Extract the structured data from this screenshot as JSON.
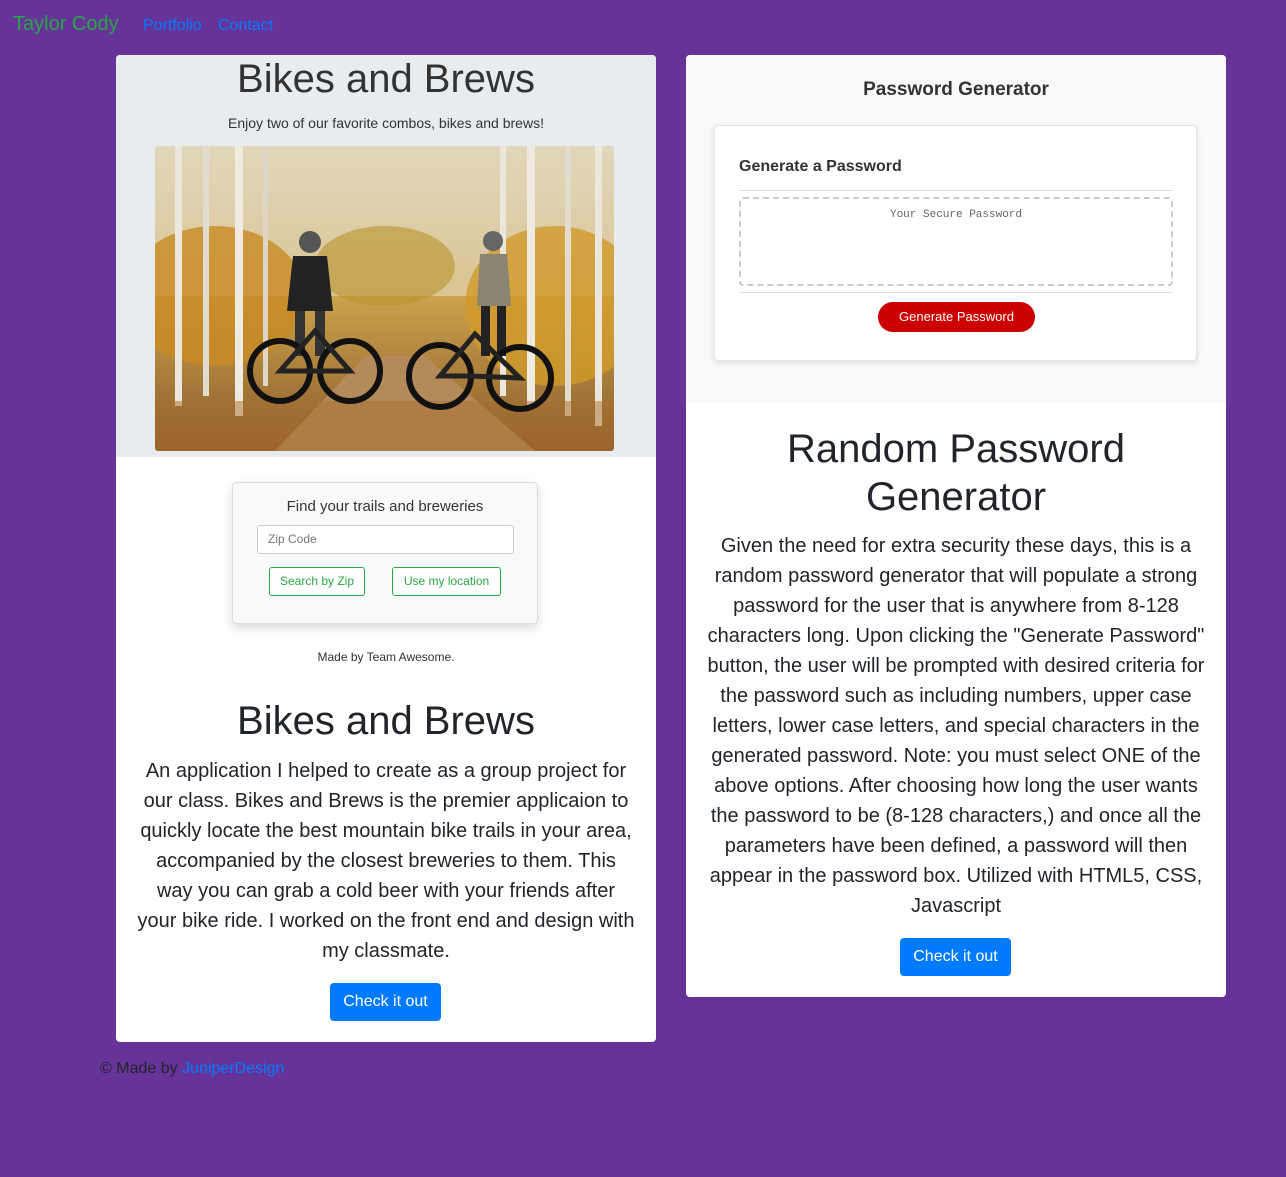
{
  "nav": {
    "brand": "Taylor Cody",
    "links": [
      "Portfolio",
      "Contact"
    ]
  },
  "projects": [
    {
      "screenshot": {
        "title": "Bikes and Brews",
        "subtitle": "Enjoy two of our favorite combos, bikes and brews!",
        "search_title": "Find your trails and breweries",
        "zip_placeholder": "Zip Code",
        "search_zip_label": "Search by Zip",
        "location_label": "Use my location",
        "credit": "Made by Team Awesome."
      },
      "title": "Bikes and Brews",
      "description": "An application I helped to create as a group project for our class. Bikes and Brews is the premier applicaion to quickly locate the best mountain bike trails in your area, accompanied by the closest breweries to them. This way you can grab a cold beer with your friends after your bike ride. I worked on the front end and design with my classmate.",
      "button_label": "Check it out"
    },
    {
      "screenshot": {
        "title": "Password Generator",
        "card_title": "Generate a Password",
        "placeholder": "Your Secure Password",
        "button_label": "Generate Password"
      },
      "title": "Random Password Generator",
      "description": "Given the need for extra security these days, this is a random password generator that will populate a strong password for the user that is anywhere from 8-128 characters long. Upon clicking the \"Generate Password\" button, the user will be prompted with desired criteria for the password such as including numbers, upper case letters, lower case letters, and special characters in the generated password. Note: you must select ONE of the above options. After choosing how long the user wants the password to be (8-128 characters,) and once all the parameters have been defined, a password will then appear in the password box. Utilized with HTML5, CSS, Javascript",
      "button_label": "Check it out"
    }
  ],
  "footer": {
    "prefix": "© Made by",
    "link": "JuniperDesign"
  },
  "colors": {
    "background": "#663399",
    "brand": "#28a745",
    "link": "#007bff",
    "generate_button": "#cc0000"
  }
}
